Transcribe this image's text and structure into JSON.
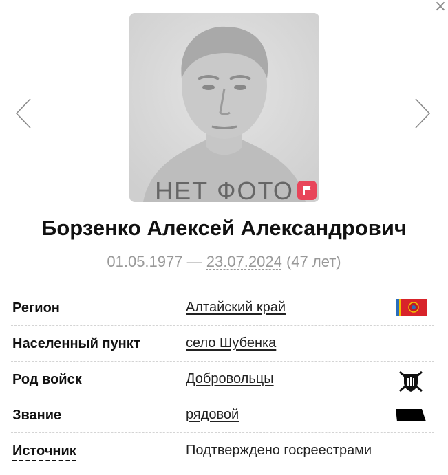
{
  "modal": {
    "close_glyph": "×"
  },
  "photo": {
    "caption": "НЕТ ФОТО",
    "flag_color": "#e8455a"
  },
  "person": {
    "full_name": "Борзенко Алексей Александрович",
    "birth_date": "01.05.1977",
    "date_separator": "—",
    "death_date": "23.07.2024",
    "age": "(47 лет)"
  },
  "details": [
    {
      "label": "Регион",
      "value": "Алтайский край",
      "link": true,
      "icon": "region-flag-icon"
    },
    {
      "label": "Населенный пункт",
      "value": "село Шубенка",
      "link": true,
      "icon": ""
    },
    {
      "label": "Род войск",
      "value": "Добровольцы",
      "link": true,
      "icon": "volunteers-emblem-icon"
    },
    {
      "label": "Звание",
      "value": "рядовой",
      "link": true,
      "icon": "rank-insignia-icon"
    },
    {
      "label": "Источник",
      "value": "Подтверждено госреестрами",
      "link": false,
      "icon": ""
    }
  ],
  "colors": {
    "muted_text": "#999999",
    "accent_red": "#e8455a",
    "separator": "#d4d4d4"
  }
}
